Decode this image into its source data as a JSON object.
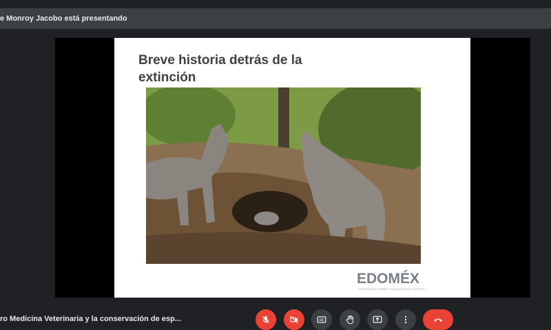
{
  "presenter_banner": "e Monroy Jacobo está presentando",
  "slide": {
    "title": "Breve historia detrás de la extinción",
    "logo_text": "EDOMÉX",
    "logo_tagline": "DECISIONES FIRMES, RESULTADOS FUERTES"
  },
  "meeting_title": "ro Medicina Veterinaria y la conservación de esp...",
  "controls": [
    {
      "name": "microphone-off",
      "state": "off"
    },
    {
      "name": "camera-off",
      "state": "off"
    },
    {
      "name": "captions",
      "state": "available"
    },
    {
      "name": "raise-hand",
      "state": "available"
    },
    {
      "name": "present-screen",
      "state": "available"
    },
    {
      "name": "more-options",
      "state": "available"
    },
    {
      "name": "leave-call",
      "state": "available"
    }
  ],
  "colors": {
    "danger": "#ea4335",
    "control_bg": "#3c4043",
    "background": "#202124"
  }
}
